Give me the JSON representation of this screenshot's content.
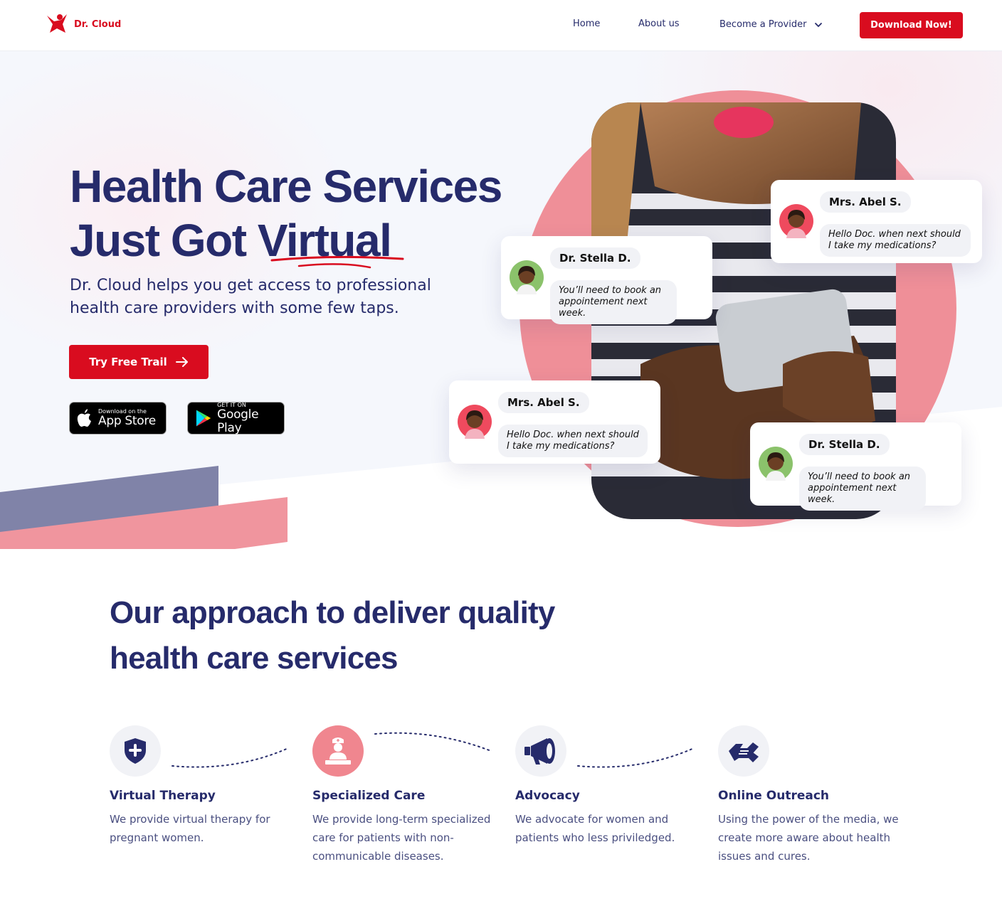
{
  "brand": {
    "name": "Dr. Cloud",
    "color": "#D90C1F",
    "navy": "#262B6B",
    "pink": "#F0868F"
  },
  "nav": {
    "home": "Home",
    "about": "About us",
    "provider": "Become a Provider",
    "download": "Download Now!"
  },
  "hero": {
    "title_line1": "Health Care Services",
    "title_line2": "Just Got Virtual",
    "subtitle": "Dr. Cloud helps you get access to professional health care providers with some few taps.",
    "cta": "Try Free Trail",
    "appstore_small": "Download on the",
    "appstore_big": "App Store",
    "googleplay_small": "GET IT ON",
    "googleplay_big": "Google Play"
  },
  "chats": [
    {
      "name": "Mrs. Abel S.",
      "message": "Hello Doc. when next should I take my medications?"
    },
    {
      "name": "Dr. Stella D.",
      "message": "You’ll need to book an appointement next week."
    },
    {
      "name": "Mrs. Abel S.",
      "message": "Hello Doc. when next should I take my medications?"
    },
    {
      "name": "Dr. Stella D.",
      "message": "You’ll need to book an appointement next week."
    }
  ],
  "approach": {
    "title_line1": "Our approach to deliver quality",
    "title_line2": "health care services",
    "features": [
      {
        "title": "Virtual Therapy",
        "desc": "We provide virtual therapy for pregnant women.",
        "icon": "shield-plus-icon"
      },
      {
        "title": "Specialized Care",
        "desc": "We provide long-term specialized care for patients with non-communicable diseases.",
        "icon": "nurse-icon"
      },
      {
        "title": "Advocacy",
        "desc": "We advocate for women and patients who less priviledged.",
        "icon": "megaphone-icon"
      },
      {
        "title": "Online Outreach",
        "desc": "Using the power of the media, we create more aware about health issues and cures.",
        "icon": "handshake-icon"
      }
    ]
  }
}
